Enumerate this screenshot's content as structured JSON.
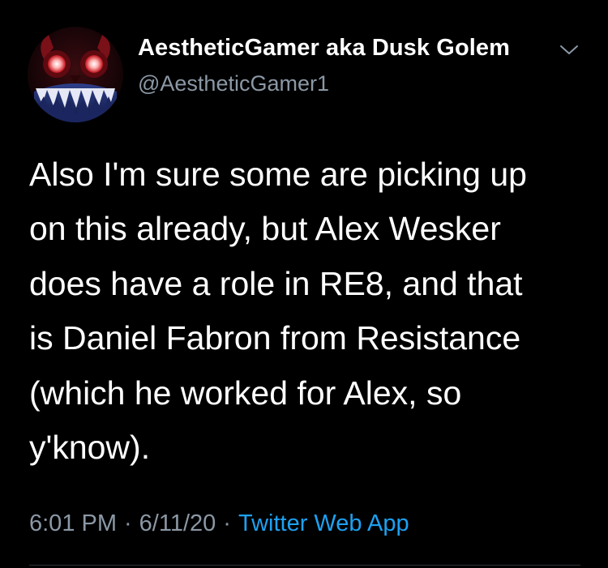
{
  "tweet": {
    "author": {
      "display_name": "AestheticGamer aka Dusk Golem",
      "handle": "@AestheticGamer1",
      "avatar_icon": "demon-face-avatar",
      "menu_icon": "chevron-down-icon"
    },
    "body_lines": [
      "Also I'm sure some are picking up",
      "on this already, but Alex Wesker",
      "does have a role in RE8, and that",
      "is Daniel Fabron from Resistance",
      "(which he worked for Alex, so",
      "y'know)."
    ],
    "time": "6:01 PM",
    "date": "6/11/20",
    "source": "Twitter Web App",
    "separator": "·"
  },
  "colors": {
    "background": "#000000",
    "text": "#ffffff",
    "secondary": "#8b98a5",
    "link": "#1da1f2"
  }
}
